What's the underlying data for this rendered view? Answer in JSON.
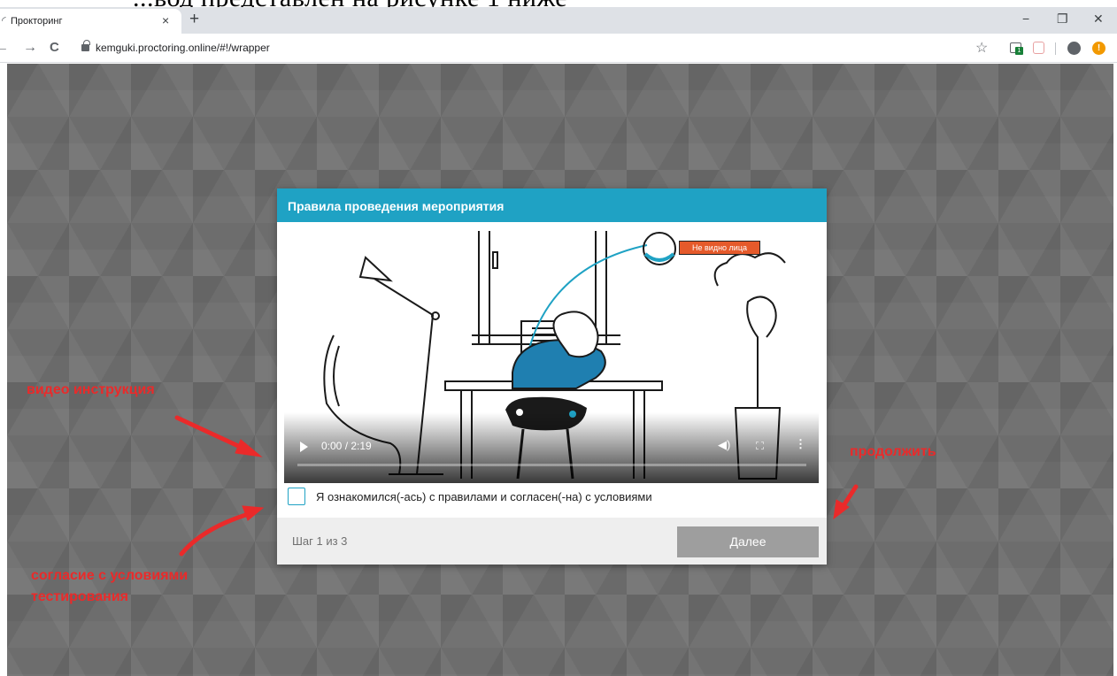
{
  "header_crop": "...вод представлен на рисунке 1 ниже",
  "browser": {
    "tab_title": "Прокторинг",
    "close_glyph": "×",
    "new_tab_glyph": "+",
    "url": "kemguki.proctoring.online/#!/wrapper",
    "extension_badge": "1",
    "window_controls": {
      "minimize": "−",
      "restore": "❐",
      "close": "✕"
    },
    "nav": {
      "back": "←",
      "forward": "→",
      "reload": "C"
    }
  },
  "modal": {
    "title": "Правила проведения мероприятия",
    "video": {
      "time": "0:00 / 2:19",
      "progress": 0,
      "badge_text": "Не видно лица"
    },
    "checkbox_label": "Я ознакомился(-ась) с правилами и согласен(-на) с условиями",
    "checked": false,
    "step": "Шаг 1 из 3",
    "next_label": "Далее"
  },
  "annotations": {
    "video": "видео инструкция",
    "continue": "продолжить",
    "agreement_line1": "согласие с условиями",
    "agreement_line2": "тестирования"
  },
  "colors": {
    "accent": "#1fa2c4",
    "annotation": "#ea2a2a",
    "button_disabled": "#9e9e9e",
    "background": "#6d6d6d"
  }
}
